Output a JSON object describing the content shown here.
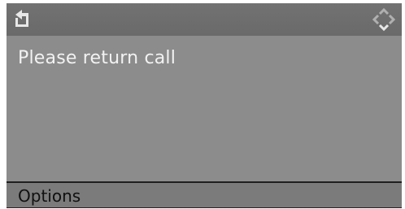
{
  "header": {
    "back_icon": "back-arrow-icon",
    "nav_icon": "navigation-arrows-icon"
  },
  "message": {
    "text": "Please return call"
  },
  "menu": {
    "options_label": "Options"
  },
  "colors": {
    "screen_bg": "#8c8c8c",
    "header_bg": "#6e6e6e",
    "text_light": "#f2f2f2",
    "selection_bar": "#7b7b7b"
  }
}
